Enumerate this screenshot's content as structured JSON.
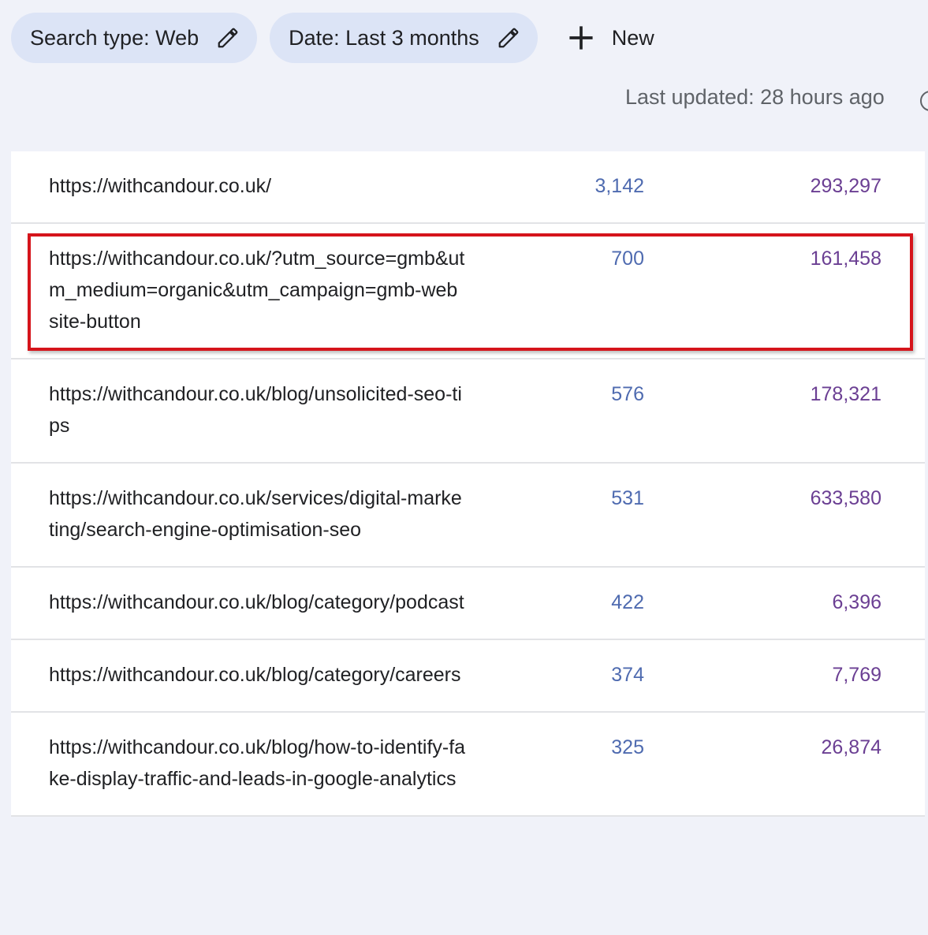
{
  "filters": {
    "search_type": "Search type: Web",
    "date": "Date: Last 3 months",
    "new_label": "New"
  },
  "status": {
    "last_updated": "Last updated: 28 hours ago"
  },
  "rows": [
    {
      "url": "https://withcandour.co.uk/",
      "clicks": "3,142",
      "impressions": "293,297"
    },
    {
      "url": "https://withcandour.co.uk/?utm_source=gmb&utm_medium=organic&utm_campaign=gmb-website-button",
      "clicks": "700",
      "impressions": "161,458"
    },
    {
      "url": "https://withcandour.co.uk/blog/unsolicited-seo-tips",
      "clicks": "576",
      "impressions": "178,321"
    },
    {
      "url": "https://withcandour.co.uk/services/digital-marketing/search-engine-optimisation-seo",
      "clicks": "531",
      "impressions": "633,580"
    },
    {
      "url": "https://withcandour.co.uk/blog/category/podcast",
      "clicks": "422",
      "impressions": "6,396"
    },
    {
      "url": "https://withcandour.co.uk/blog/category/careers",
      "clicks": "374",
      "impressions": "7,769"
    },
    {
      "url": "https://withcandour.co.uk/blog/how-to-identify-fake-display-traffic-and-leads-in-google-analytics",
      "clicks": "325",
      "impressions": "26,874"
    }
  ],
  "colors": {
    "background": "#f0f2f9",
    "chip": "#dce4f6",
    "clicks": "#4f6bb0",
    "impressions": "#6b3f93",
    "highlight": "#d5141b"
  },
  "icons": [
    "edit-icon",
    "plus-icon",
    "info-icon"
  ]
}
